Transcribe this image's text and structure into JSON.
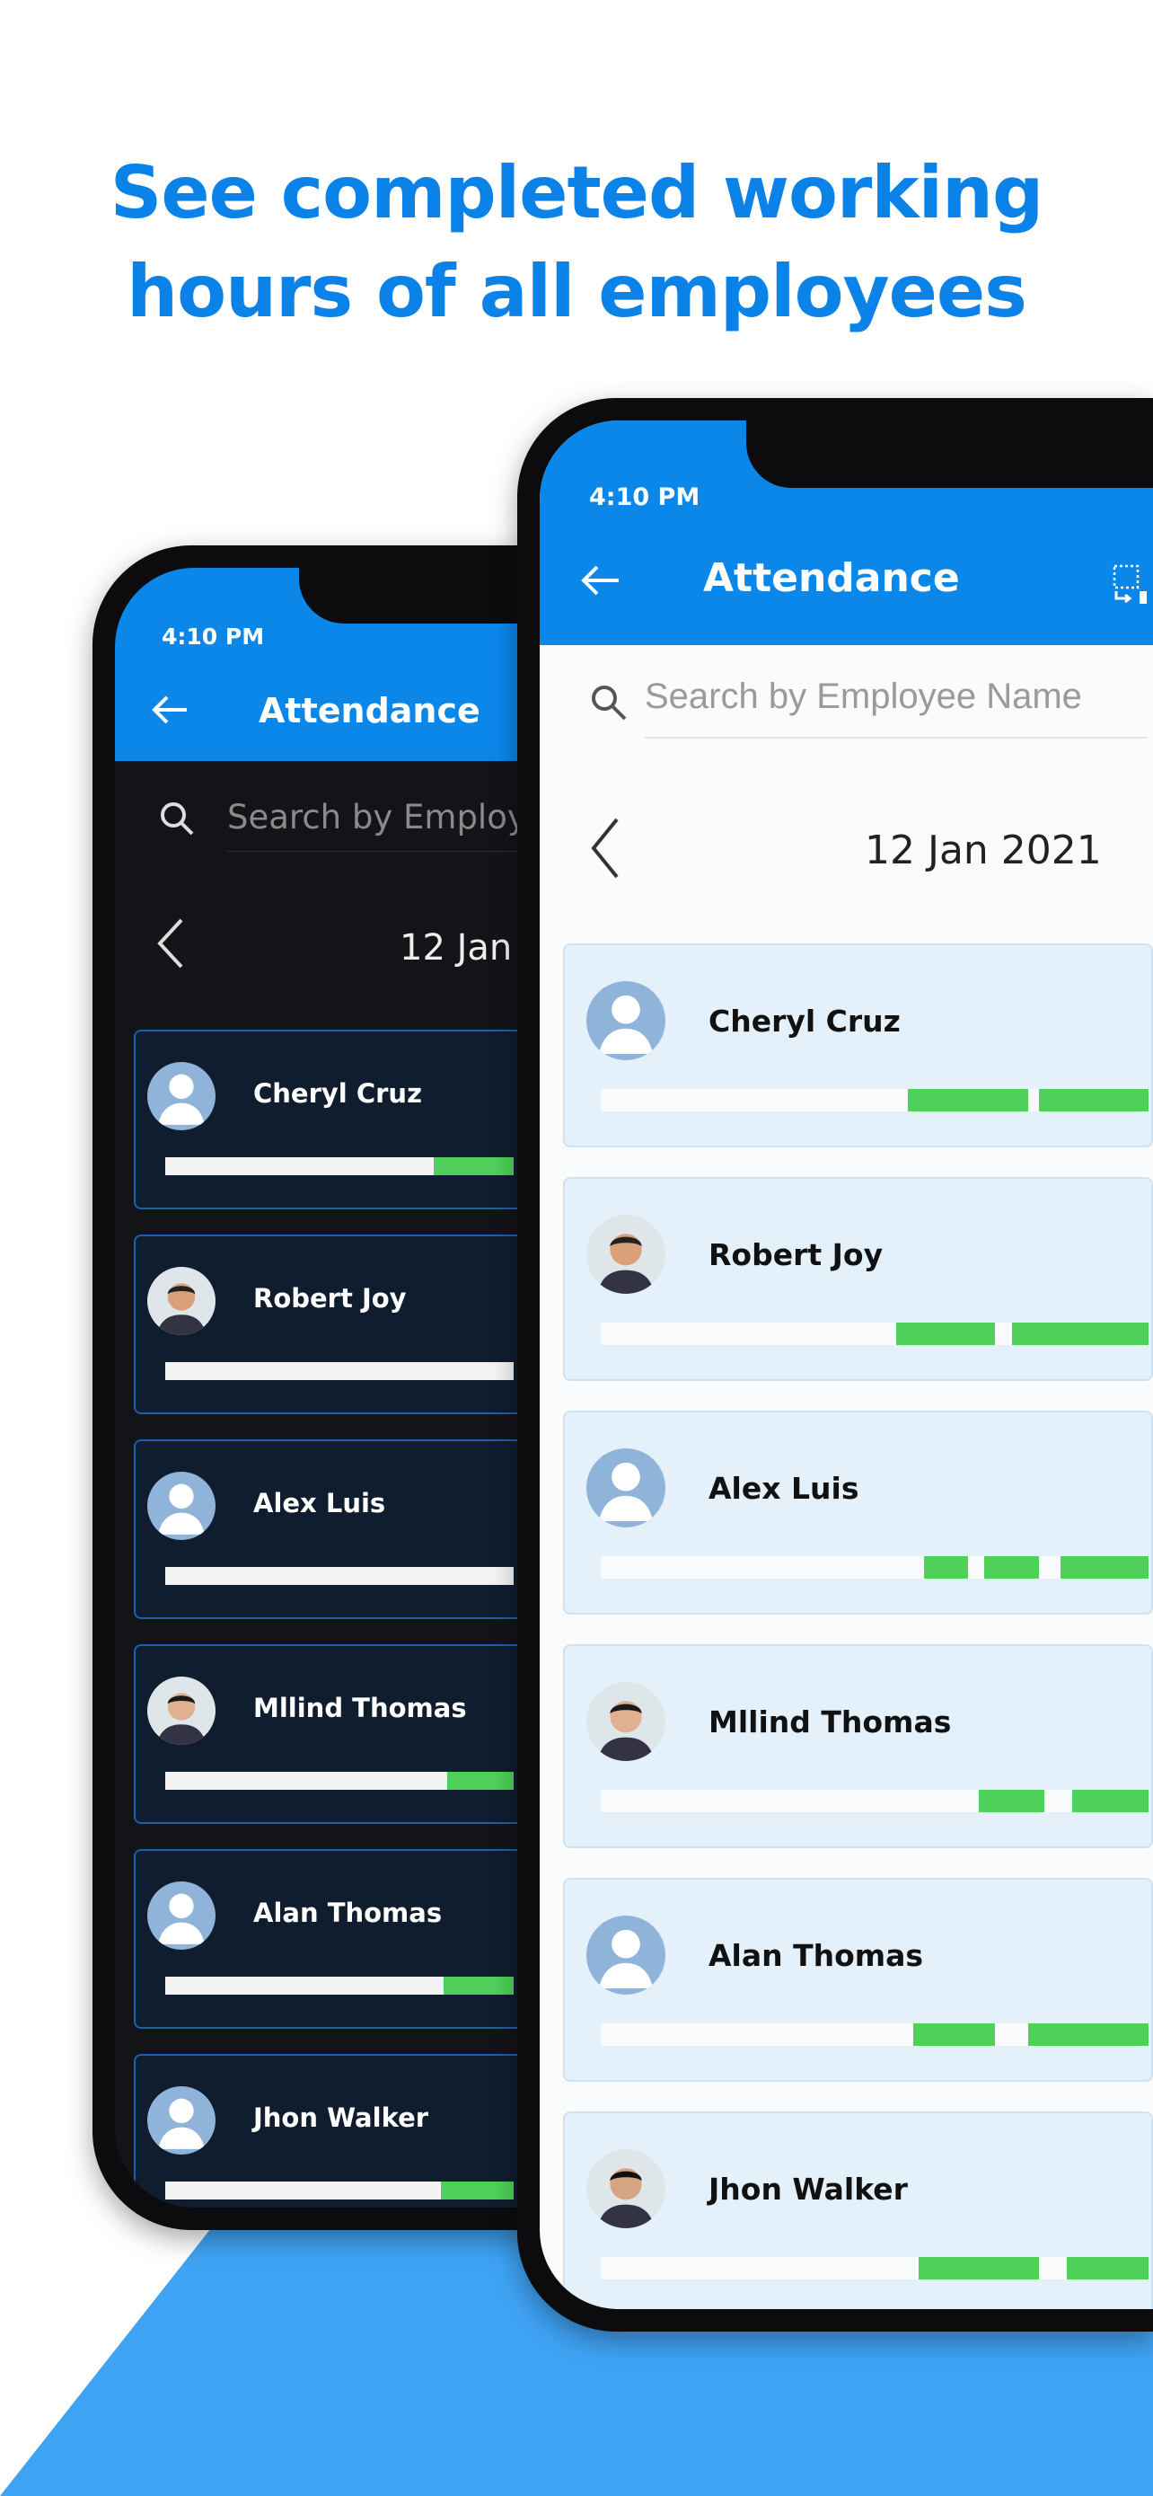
{
  "headline": {
    "line1": "See completed working",
    "line2": "hours of all employees"
  },
  "colors": {
    "brand": "#0b87ea",
    "headline": "#0b82e8",
    "bottom_shape": "#3fa3f4",
    "progress": "#4fd05a",
    "light_card": "#e4f1fb",
    "dark_card": "#0f1d2e"
  },
  "back_phone": {
    "theme": "dark",
    "time": "4:10 PM",
    "title": "Attendance",
    "search_placeholder": "Search by Employee Name",
    "date": "12 Jan 2021",
    "employees": [
      {
        "name": "Cheryl Cruz",
        "avatar": "placeholder",
        "segments": [
          [
            0.77,
            1
          ]
        ]
      },
      {
        "name": "Robert Joy",
        "avatar": "photo",
        "segments": []
      },
      {
        "name": "Alex Luis",
        "avatar": "placeholder",
        "segments": []
      },
      {
        "name": "Mllind Thomas",
        "avatar": "photo",
        "segments": [
          [
            0.81,
            1
          ]
        ]
      },
      {
        "name": "Alan Thomas",
        "avatar": "placeholder",
        "segments": [
          [
            0.8,
            1
          ]
        ]
      },
      {
        "name": "Jhon Walker",
        "avatar": "placeholder",
        "segments": [
          [
            0.79,
            1
          ]
        ]
      }
    ]
  },
  "front_phone": {
    "theme": "light",
    "time": "4:10 PM",
    "title": "Attendance",
    "search_placeholder": "Search by Employee Name",
    "date": "12 Jan 2021",
    "employees": [
      {
        "name": "Cheryl Cruz",
        "avatar": "placeholder",
        "segments": [
          [
            0.56,
            0.78
          ],
          [
            0.8,
            1
          ]
        ]
      },
      {
        "name": "Robert Joy",
        "avatar": "photo",
        "segments": [
          [
            0.54,
            0.72
          ],
          [
            0.75,
            1
          ]
        ]
      },
      {
        "name": "Alex Luis",
        "avatar": "placeholder",
        "segments": [
          [
            0.59,
            0.67
          ],
          [
            0.7,
            0.8
          ],
          [
            0.84,
            1
          ]
        ]
      },
      {
        "name": "Mllind Thomas",
        "avatar": "photo",
        "segments": [
          [
            0.69,
            0.81
          ],
          [
            0.86,
            1
          ]
        ]
      },
      {
        "name": "Alan Thomas",
        "avatar": "placeholder",
        "segments": [
          [
            0.57,
            0.72
          ],
          [
            0.78,
            1
          ]
        ]
      },
      {
        "name": "Jhon Walker",
        "avatar": "photo",
        "segments": [
          [
            0.58,
            0.8
          ],
          [
            0.85,
            1
          ]
        ]
      }
    ]
  }
}
